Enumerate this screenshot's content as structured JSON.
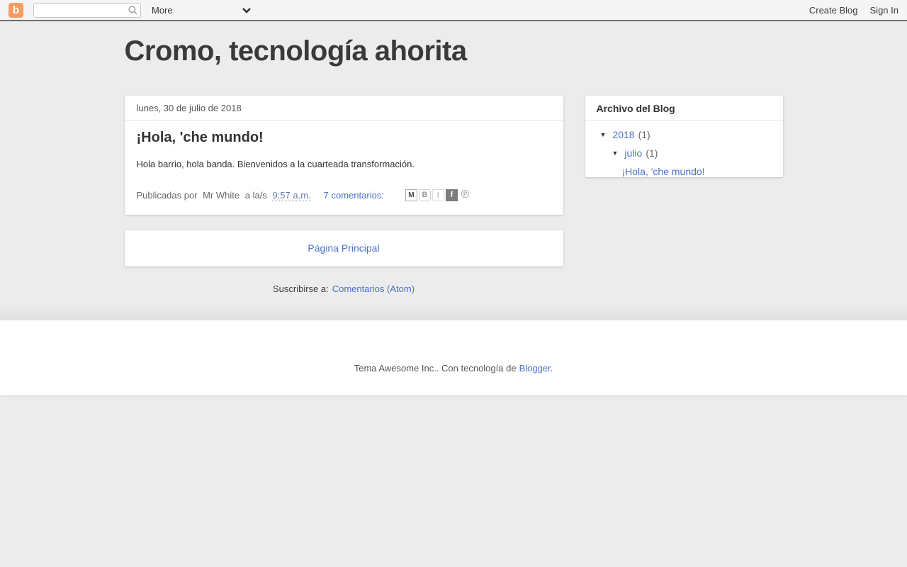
{
  "navbar": {
    "logo_glyph": "b",
    "search_value": "",
    "more_label": "More",
    "create_blog_label": "Create Blog",
    "sign_in_label": "Sign In"
  },
  "header": {
    "blog_title": "Cromo, tecnología ahorita"
  },
  "main": {
    "post": {
      "date_header": "lunes, 30 de julio de 2018",
      "title": "¡Hola, 'che mundo!",
      "body": "Hola barrio, hola banda. Bienvenidos a la cuarteada transformación.",
      "byline_prefix": "Publicadas por",
      "author": "Mr White",
      "byline_connector": "a la/s",
      "timestamp": "9:57 a.m.",
      "comments_link": "7 comentarios:",
      "share_icons": [
        {
          "name": "email-icon",
          "glyph": "M"
        },
        {
          "name": "blogthis-icon",
          "glyph": "B"
        },
        {
          "name": "twitter-icon",
          "glyph": "t"
        },
        {
          "name": "facebook-icon",
          "glyph": "f"
        },
        {
          "name": "pinterest-icon",
          "glyph": "℗"
        }
      ]
    },
    "pager": {
      "home_link": "Página Principal"
    },
    "subscribe": {
      "prefix": "Suscribirse a:",
      "link_label": "Comentarios (Atom)"
    }
  },
  "sidebar": {
    "archive": {
      "title": "Archivo del Blog",
      "toggle_glyph": "▼",
      "year": {
        "label": "2018",
        "count": "(1)"
      },
      "month": {
        "label": "julio",
        "count": "(1)"
      },
      "post_link": "¡Hola, 'che mundo!"
    }
  },
  "footer": {
    "attribution_prefix": "Tema Awesome Inc.. Con tecnología de",
    "attribution_link": "Blogger",
    "attribution_suffix": "."
  },
  "colors": {
    "link_blue": "#4a72c9",
    "logo_orange": "#f79b61",
    "navbar_bg": "#f5f5f5",
    "page_bg": "#ececec",
    "text_dark": "#333333",
    "text_gray": "#666666"
  }
}
